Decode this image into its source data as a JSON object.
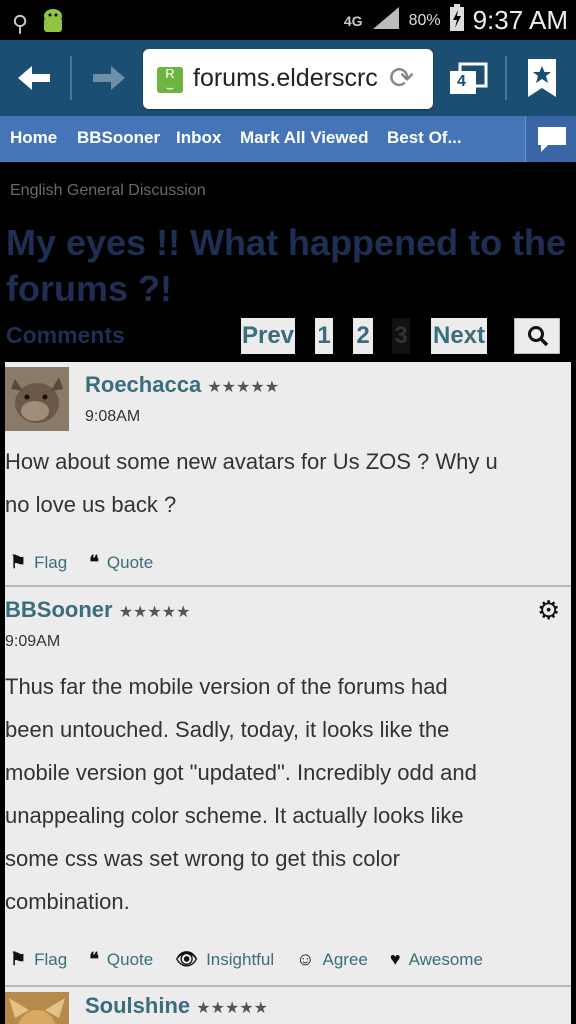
{
  "status": {
    "network": "4G",
    "battery": "80%",
    "time": "9:37 AM"
  },
  "browser": {
    "url": "forums.elderscrc",
    "tab_count": "4"
  },
  "site_nav": {
    "items": [
      "Home",
      "BBSooner",
      "Inbox",
      "Mark All Viewed",
      "Best Of..."
    ]
  },
  "page": {
    "breadcrumb": "English General Discussion",
    "title_line1": "My eyes !! What happened to the",
    "title_line2": "forums ?!",
    "comments_label": "Comments",
    "pager": {
      "prev": "Prev",
      "p1": "1",
      "p2": "2",
      "p3": "3",
      "next": "Next"
    }
  },
  "posts": [
    {
      "author": "Roechacca",
      "stars": "★★★★★",
      "time": "9:08AM",
      "body_lines": [
        "How about some new avatars for Us ZOS ? Why u",
        "no love us back ?"
      ],
      "actions": {
        "flag": "Flag",
        "quote": "Quote"
      }
    },
    {
      "author": "BBSooner",
      "stars": "★★★★★",
      "time": "9:09AM",
      "body_lines": [
        "Thus far the mobile version of the forums had",
        "been untouched. Sadly, today, it looks like the",
        "mobile version got \"updated\". Incredibly odd and",
        "unappealing color scheme. It actually looks like",
        "some css was set wrong to get this color",
        "combination."
      ],
      "actions": {
        "flag": "Flag",
        "quote": "Quote",
        "insightful": "Insightful",
        "agree": "Agree",
        "awesome": "Awesome"
      }
    },
    {
      "author": "Soulshine",
      "stars": "★★★★★"
    }
  ],
  "colors": {
    "browser_bar": "#1b4e73",
    "site_nav": "#4675b7",
    "link_teal": "#3a6d7d",
    "title_navy": "#1f2f53"
  }
}
